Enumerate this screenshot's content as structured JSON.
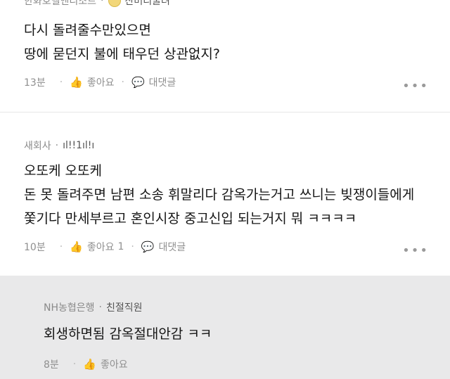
{
  "comments": [
    {
      "author": "한화호텔앤리조트",
      "badge": "잔머리굴려",
      "lines": [
        "다시 돌려줄수만있으면",
        "땅에 묻던지 불에 태우던 상관없지?"
      ],
      "time": "13분",
      "like_label": "좋아요",
      "like_count": "",
      "reply_label": "대댓글",
      "more": "•••"
    },
    {
      "author": "새회사",
      "badge": "ıl!!1ıl!ı",
      "lines": [
        "오또케 오또케",
        "돈 못 돌려주면 남편 소송 휘말리다 감옥가는거고 쓰니는 빚쟁이들에게",
        "쫓기다 만세부르고 혼인시장 중고신입 되는거지 뭐 ㅋㅋㅋㅋ"
      ],
      "time": "10분",
      "like_label": "좋아요",
      "like_count": "1",
      "reply_label": "대댓글",
      "more": "•••"
    },
    {
      "author": "NH농협은행",
      "badge": "친절직원",
      "lines": [
        "회생하면됨 감옥절대안감 ㅋㅋ"
      ],
      "time": "8분",
      "like_label": "좋아요",
      "like_count": "",
      "reply_label": "",
      "more": ""
    }
  ],
  "icons": {
    "like": "thumbs-up-icon",
    "reply": "speech-bubble-icon",
    "more": "more-dots-icon"
  },
  "colors": {
    "background": "#ffffff",
    "reply_background": "#e9e9ea",
    "meta_gray": "#8a8a8a",
    "badge_blue": "#3a6fb5"
  }
}
